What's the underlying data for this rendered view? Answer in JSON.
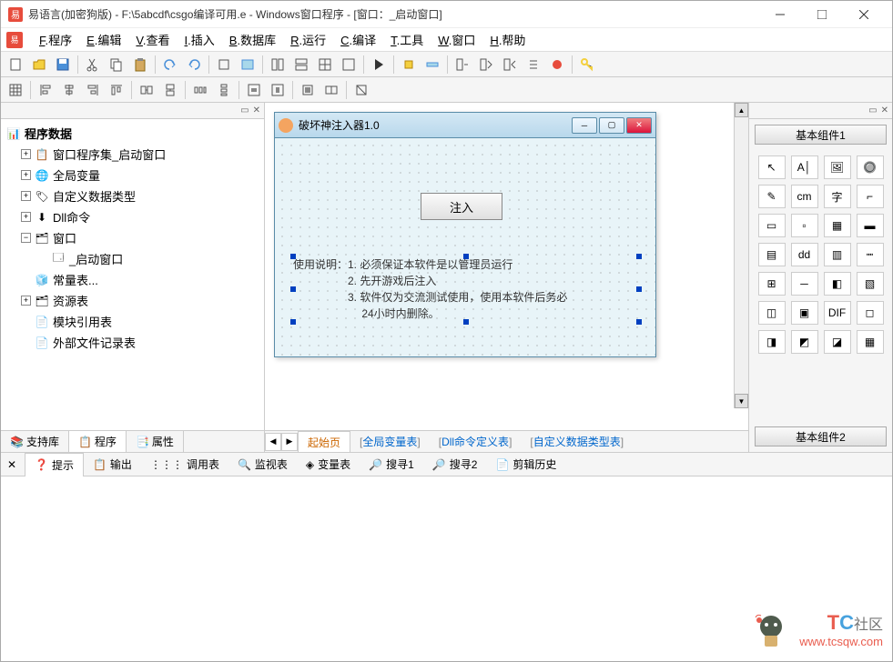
{
  "titlebar": {
    "text": "易语言(加密狗版) - F:\\5abcdf\\csgo编译可用.e - Windows窗口程序 - [窗口：_启动窗口]"
  },
  "menus": [
    {
      "key": "F",
      "label": "程序"
    },
    {
      "key": "E",
      "label": "编辑"
    },
    {
      "key": "V",
      "label": "查看"
    },
    {
      "key": "I",
      "label": "插入"
    },
    {
      "key": "B",
      "label": "数据库"
    },
    {
      "key": "R",
      "label": "运行"
    },
    {
      "key": "C",
      "label": "编译"
    },
    {
      "key": "T",
      "label": "工具"
    },
    {
      "key": "W",
      "label": "窗口"
    },
    {
      "key": "H",
      "label": "帮助"
    }
  ],
  "left": {
    "root": "程序数据",
    "items": [
      {
        "indent": 1,
        "exp": "+",
        "icon": "📋",
        "label": "窗口程序集_启动窗口"
      },
      {
        "indent": 1,
        "exp": "+",
        "icon": "🌐",
        "label": "全局变量"
      },
      {
        "indent": 1,
        "exp": "+",
        "icon": "🏷",
        "label": "自定义数据类型"
      },
      {
        "indent": 1,
        "exp": "+",
        "icon": "⬇",
        "label": "Dll命令"
      },
      {
        "indent": 1,
        "exp": "−",
        "icon": "🗂",
        "label": "窗口"
      },
      {
        "indent": 2,
        "exp": "",
        "icon": "🗔",
        "label": "_启动窗口"
      },
      {
        "indent": 1,
        "exp": "",
        "icon": "🧊",
        "label": "常量表..."
      },
      {
        "indent": 1,
        "exp": "+",
        "icon": "🗂",
        "label": "资源表"
      },
      {
        "indent": 1,
        "exp": "",
        "icon": "📄",
        "label": "模块引用表"
      },
      {
        "indent": 1,
        "exp": "",
        "icon": "📄",
        "label": "外部文件记录表"
      }
    ],
    "tabs": [
      {
        "icon": "📚",
        "label": "支持库"
      },
      {
        "icon": "📋",
        "label": "程序",
        "active": true
      },
      {
        "icon": "📑",
        "label": "属性"
      }
    ]
  },
  "form": {
    "title": "破坏神注入器1.0",
    "button": "注入",
    "label_lines": [
      "使用说明：1. 必须保证本软件是以管理员运行",
      "　　　　　2. 先开游戏后注入",
      "　　　　　3. 软件仅为交流测试使用，使用本软件后务必",
      "　　　　　　 24小时内删除。"
    ]
  },
  "center_tabs": [
    {
      "label": "起始页",
      "active": true
    },
    {
      "label": "全局变量表"
    },
    {
      "label": "Dll命令定义表"
    },
    {
      "label": "自定义数据类型表"
    }
  ],
  "right": {
    "header": "基本组件1",
    "footer": "基本组件2"
  },
  "bottom_tabs": [
    {
      "icon": "❓",
      "label": "提示",
      "active": true
    },
    {
      "icon": "📋",
      "label": "输出"
    },
    {
      "icon": "⋮⋮⋮",
      "label": "调用表"
    },
    {
      "icon": "🔍",
      "label": "监视表"
    },
    {
      "icon": "◈",
      "label": "变量表"
    },
    {
      "icon": "🔎",
      "label": "搜寻1"
    },
    {
      "icon": "🔎",
      "label": "搜寻2"
    },
    {
      "icon": "📄",
      "label": "剪辑历史"
    }
  ],
  "watermark": {
    "text1": "TC",
    "text2": "社区",
    "url": "www.tcsqw.com"
  }
}
